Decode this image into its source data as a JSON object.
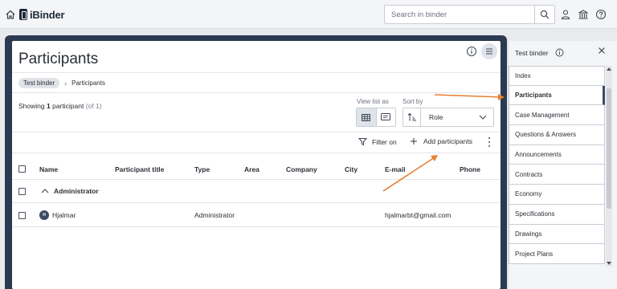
{
  "topbar": {
    "brand": "iBinder",
    "search_placeholder": "Search in binder",
    "icons": [
      "home-icon",
      "search-icon",
      "user-icon",
      "bank-icon",
      "help-icon"
    ]
  },
  "page": {
    "title": "Participants",
    "breadcrumb": {
      "parent": "Test binder",
      "current": "Participants"
    },
    "showing": {
      "prefix": "Showing",
      "count": "1",
      "noun": "participant",
      "total": "(of 1)"
    },
    "view_list_label": "View list as",
    "sort_by_label": "Sort by",
    "sort_value": "Role",
    "filter_label": "Filter on",
    "add_label": "Add participants"
  },
  "table": {
    "columns": [
      "Name",
      "Participant title",
      "Type",
      "Area",
      "Company",
      "City",
      "E-mail",
      "Phone"
    ],
    "group": "Administrator",
    "rows": [
      {
        "initial": "H",
        "name": "Hjalmar",
        "title": "",
        "type": "Administrator",
        "area": "",
        "company": "",
        "city": "",
        "email": "hjalmarbt@gmail.com",
        "phone": ""
      }
    ]
  },
  "side_panel": {
    "title": "Test binder",
    "items": [
      {
        "label": "Index"
      },
      {
        "label": "Participants"
      },
      {
        "label": "Case Management"
      },
      {
        "label": "Questions & Answers"
      },
      {
        "label": "Announcements"
      },
      {
        "label": "Contracts"
      },
      {
        "label": "Economy"
      },
      {
        "label": "Specifications"
      },
      {
        "label": "Drawings"
      },
      {
        "label": "Project Plans"
      }
    ],
    "active_index": 1
  },
  "colors": {
    "frame_navy": "#2b3a52",
    "annotation_orange": "#e87f2e"
  }
}
